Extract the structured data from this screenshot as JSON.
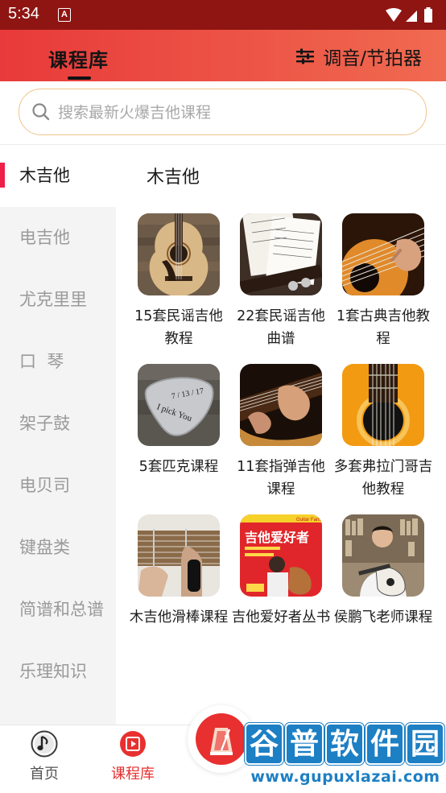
{
  "status_bar": {
    "time": "5:34",
    "notification_letter": "A"
  },
  "header": {
    "tab_title": "课程库",
    "tuner_label": "调音/节拍器"
  },
  "search": {
    "placeholder": "搜索最新火爆吉他课程"
  },
  "sidebar": {
    "items": [
      {
        "label": "木吉他",
        "active": true
      },
      {
        "label": "电吉他"
      },
      {
        "label": "尤克里里"
      },
      {
        "label": "口  琴"
      },
      {
        "label": "架子鼓"
      },
      {
        "label": "电贝司"
      },
      {
        "label": "键盘类"
      },
      {
        "label": "简谱和总谱"
      },
      {
        "label": "乐理知识"
      }
    ]
  },
  "content": {
    "title": "木吉他",
    "courses": [
      {
        "label": "15套民谣吉他教程",
        "thumb": "acoustic-guitar-body"
      },
      {
        "label": "22套民谣吉他曲谱",
        "thumb": "sheet-music"
      },
      {
        "label": "1套古典吉他教程",
        "thumb": "classical-strings-hand"
      },
      {
        "label": "5套匹克课程",
        "thumb": "guitar-pick"
      },
      {
        "label": "11套指弹吉他课程",
        "thumb": "fingerstyle-hands"
      },
      {
        "label": "多套弗拉门哥吉他教程",
        "thumb": "flamenco-soundhole"
      },
      {
        "label": "木吉他滑棒课程",
        "thumb": "slide-bottleneck"
      },
      {
        "label": "吉他爱好者丛书",
        "thumb": "guitar-fans-book"
      },
      {
        "label": "侯鹏飞老师课程",
        "thumb": "teacher-portrait"
      }
    ],
    "pick_text_top": "7 / 13 / 17",
    "pick_text_bottom": "I pick You",
    "book_cover_title": "吉他爱好者",
    "book_cover_banner": "Guitar Fans"
  },
  "bottom_nav": {
    "items": [
      {
        "label": "首页",
        "icon": "music-note-icon",
        "active": false
      },
      {
        "label": "课程库",
        "icon": "play-course-icon",
        "active": true
      }
    ],
    "center_button_icon": "metronome-icon"
  },
  "watermark": {
    "chars": [
      "谷",
      "普",
      "软",
      "件",
      "园"
    ],
    "url": "www.gupuxlazai.com"
  },
  "colors": {
    "header_start": "#e83a3a",
    "header_end": "#f06a50",
    "accent_red": "#ee1f49",
    "nav_active": "#e7302f",
    "search_border": "#f0c48a",
    "watermark_blue": "#1d7fc4"
  }
}
